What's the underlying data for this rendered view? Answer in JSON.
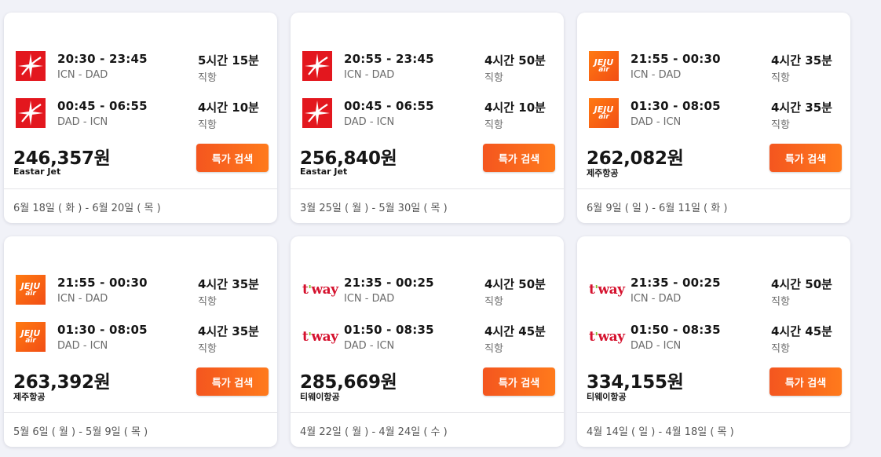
{
  "cards": [
    {
      "legs": [
        {
          "logo": "eastar-logo-icon",
          "times": "20:30 - 23:45",
          "route": "ICN - DAD",
          "duration": "5시간 15분",
          "stops": "직항"
        },
        {
          "logo": "eastar-logo-icon",
          "times": "00:45 - 06:55",
          "route": "DAD - ICN",
          "duration": "4시간 10분",
          "stops": "직항"
        }
      ],
      "price": "246,357원",
      "airline": "Eastar Jet",
      "button": "특가 검색",
      "dates": "6월 18일 ( 화 ) - 6월 20일 ( 목 )"
    },
    {
      "legs": [
        {
          "logo": "eastar-logo-icon",
          "times": "20:55 - 23:45",
          "route": "ICN - DAD",
          "duration": "4시간 50분",
          "stops": "직항"
        },
        {
          "logo": "eastar-logo-icon",
          "times": "00:45 - 06:55",
          "route": "DAD - ICN",
          "duration": "4시간 10분",
          "stops": "직항"
        }
      ],
      "price": "256,840원",
      "airline": "Eastar Jet",
      "button": "특가 검색",
      "dates": "3월 25일 ( 월 ) - 5월 30일 ( 목 )"
    },
    {
      "legs": [
        {
          "logo": "jeju-air-logo-icon",
          "times": "21:55 - 00:30",
          "route": "ICN - DAD",
          "duration": "4시간 35분",
          "stops": "직항"
        },
        {
          "logo": "jeju-air-logo-icon",
          "times": "01:30 - 08:05",
          "route": "DAD - ICN",
          "duration": "4시간 35분",
          "stops": "직항"
        }
      ],
      "price": "262,082원",
      "airline": "제주항공",
      "button": "특가 검색",
      "dates": "6월 9일 ( 일 ) - 6월 11일 ( 화 )"
    },
    {
      "legs": [
        {
          "logo": "jeju-air-logo-icon",
          "times": "21:55 - 00:30",
          "route": "ICN - DAD",
          "duration": "4시간 35분",
          "stops": "직항"
        },
        {
          "logo": "jeju-air-logo-icon",
          "times": "01:30 - 08:05",
          "route": "DAD - ICN",
          "duration": "4시간 35분",
          "stops": "직항"
        }
      ],
      "price": "263,392원",
      "airline": "제주항공",
      "button": "특가 검색",
      "dates": "5월 6일 ( 월 ) - 5월 9일 ( 목 )"
    },
    {
      "legs": [
        {
          "logo": "tway-logo-icon",
          "times": "21:35 - 00:25",
          "route": "ICN - DAD",
          "duration": "4시간 50분",
          "stops": "직항"
        },
        {
          "logo": "tway-logo-icon",
          "times": "01:50 - 08:35",
          "route": "DAD - ICN",
          "duration": "4시간 45분",
          "stops": "직항"
        }
      ],
      "price": "285,669원",
      "airline": "티웨이항공",
      "button": "특가 검색",
      "dates": "4월 22일 ( 월 ) - 4월 24일 ( 수 )"
    },
    {
      "legs": [
        {
          "logo": "tway-logo-icon",
          "times": "21:35 - 00:25",
          "route": "ICN - DAD",
          "duration": "4시간 50분",
          "stops": "직항"
        },
        {
          "logo": "tway-logo-icon",
          "times": "01:50 - 08:35",
          "route": "DAD - ICN",
          "duration": "4시간 45분",
          "stops": "직항"
        }
      ],
      "price": "334,155원",
      "airline": "티웨이항공",
      "button": "특가 검색",
      "dates": "4월 14일 ( 일 ) - 4월 18일 ( 목 )"
    }
  ],
  "logos": {
    "eastar": {
      "text": "",
      "color": "#e3171e"
    },
    "jeju": {
      "line1": "JEJU",
      "line2": "air",
      "color": "#f5621a"
    },
    "tway": {
      "text": "t",
      "apostrophe": "'",
      "rest": "way",
      "color": "#d5122e",
      "accent": "#7cbd2a"
    }
  },
  "colors": {
    "button": "#f4561f",
    "background": "#f1f2f8"
  }
}
